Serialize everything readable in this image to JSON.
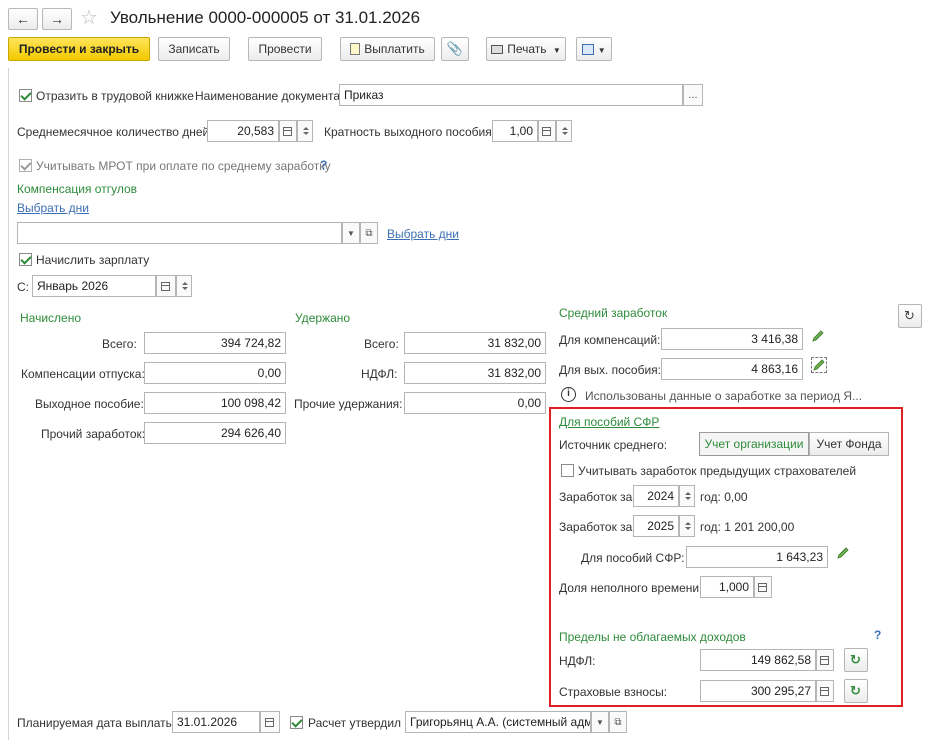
{
  "window": {
    "title": "Увольнение 0000-000005 от 31.01.2026"
  },
  "toolbar": {
    "post_close": "Провести и закрыть",
    "save": "Записать",
    "post": "Провести",
    "pay": "Выплатить",
    "print": "Печать"
  },
  "form": {
    "labor_book_label": "Отразить в трудовой книжке",
    "doc_name_label": "Наименование документа:",
    "doc_name_value": "Приказ",
    "avg_days_label": "Среднемесячное количество дней:",
    "avg_days_value": "20,583",
    "multiplicity_label": "Кратность выходного пособия:",
    "multiplicity_value": "1,00",
    "mrot_label": "Учитывать МРОТ при оплате по среднему заработку",
    "help_q": "?",
    "vacation_comp_title": "Компенсация отгулов",
    "choose_days": "Выбрать дни",
    "choose_days2": "Выбрать дни",
    "accrue_salary_label": "Начислить зарплату",
    "from_label": "С:",
    "from_value": "Январь 2026"
  },
  "accrued": {
    "title": "Начислено",
    "rows": [
      {
        "label": "Всего:",
        "value": "394 724,82"
      },
      {
        "label": "Компенсации отпуска:",
        "value": "0,00"
      },
      {
        "label": "Выходное пособие:",
        "value": "100 098,42"
      },
      {
        "label": "Прочий заработок:",
        "value": "294 626,40"
      }
    ]
  },
  "withheld": {
    "title": "Удержано",
    "rows": [
      {
        "label": "Всего:",
        "value": "31 832,00"
      },
      {
        "label": "НДФЛ:",
        "value": "31 832,00"
      },
      {
        "label": "Прочие удержания:",
        "value": "0,00"
      }
    ]
  },
  "avg_earnings": {
    "title": "Средний заработок",
    "compensation_label": "Для компенсаций:",
    "compensation_value": "3 416,38",
    "severance_label": "Для вых. пособия:",
    "severance_value": "4 863,16",
    "info_text": "Использованы данные о заработке за период Я..."
  },
  "sfr": {
    "link": "Для пособий СФР",
    "source_label": "Источник среднего:",
    "source_org": "Учет организации",
    "source_fund": "Учет Фонда",
    "prev_insurers_label": "Учитывать заработок предыдущих страхователей",
    "earnings1_label": "Заработок за",
    "earnings1_year": "2024",
    "earnings1_text": "год: 0,00",
    "earnings2_label": "Заработок за",
    "earnings2_year": "2025",
    "earnings2_text": "год: 1 201 200,00",
    "benefit_label": "Для пособий СФР:",
    "benefit_value": "1 643,23",
    "parttime_label": "Доля неполного времени:",
    "parttime_value": "1,000"
  },
  "limits": {
    "title": "Пределы не облагаемых доходов",
    "help_q": "?",
    "ndfl_label": "НДФЛ:",
    "ndfl_value": "149 862,58",
    "insurance_label": "Страховые взносы:",
    "insurance_value": "300 295,27"
  },
  "footer": {
    "pay_date_label": "Планируемая дата выплаты:",
    "pay_date_value": "31.01.2026",
    "approved_label": "Расчет утвердил",
    "approver_value": "Григорьянц А.А. (системный адми"
  }
}
